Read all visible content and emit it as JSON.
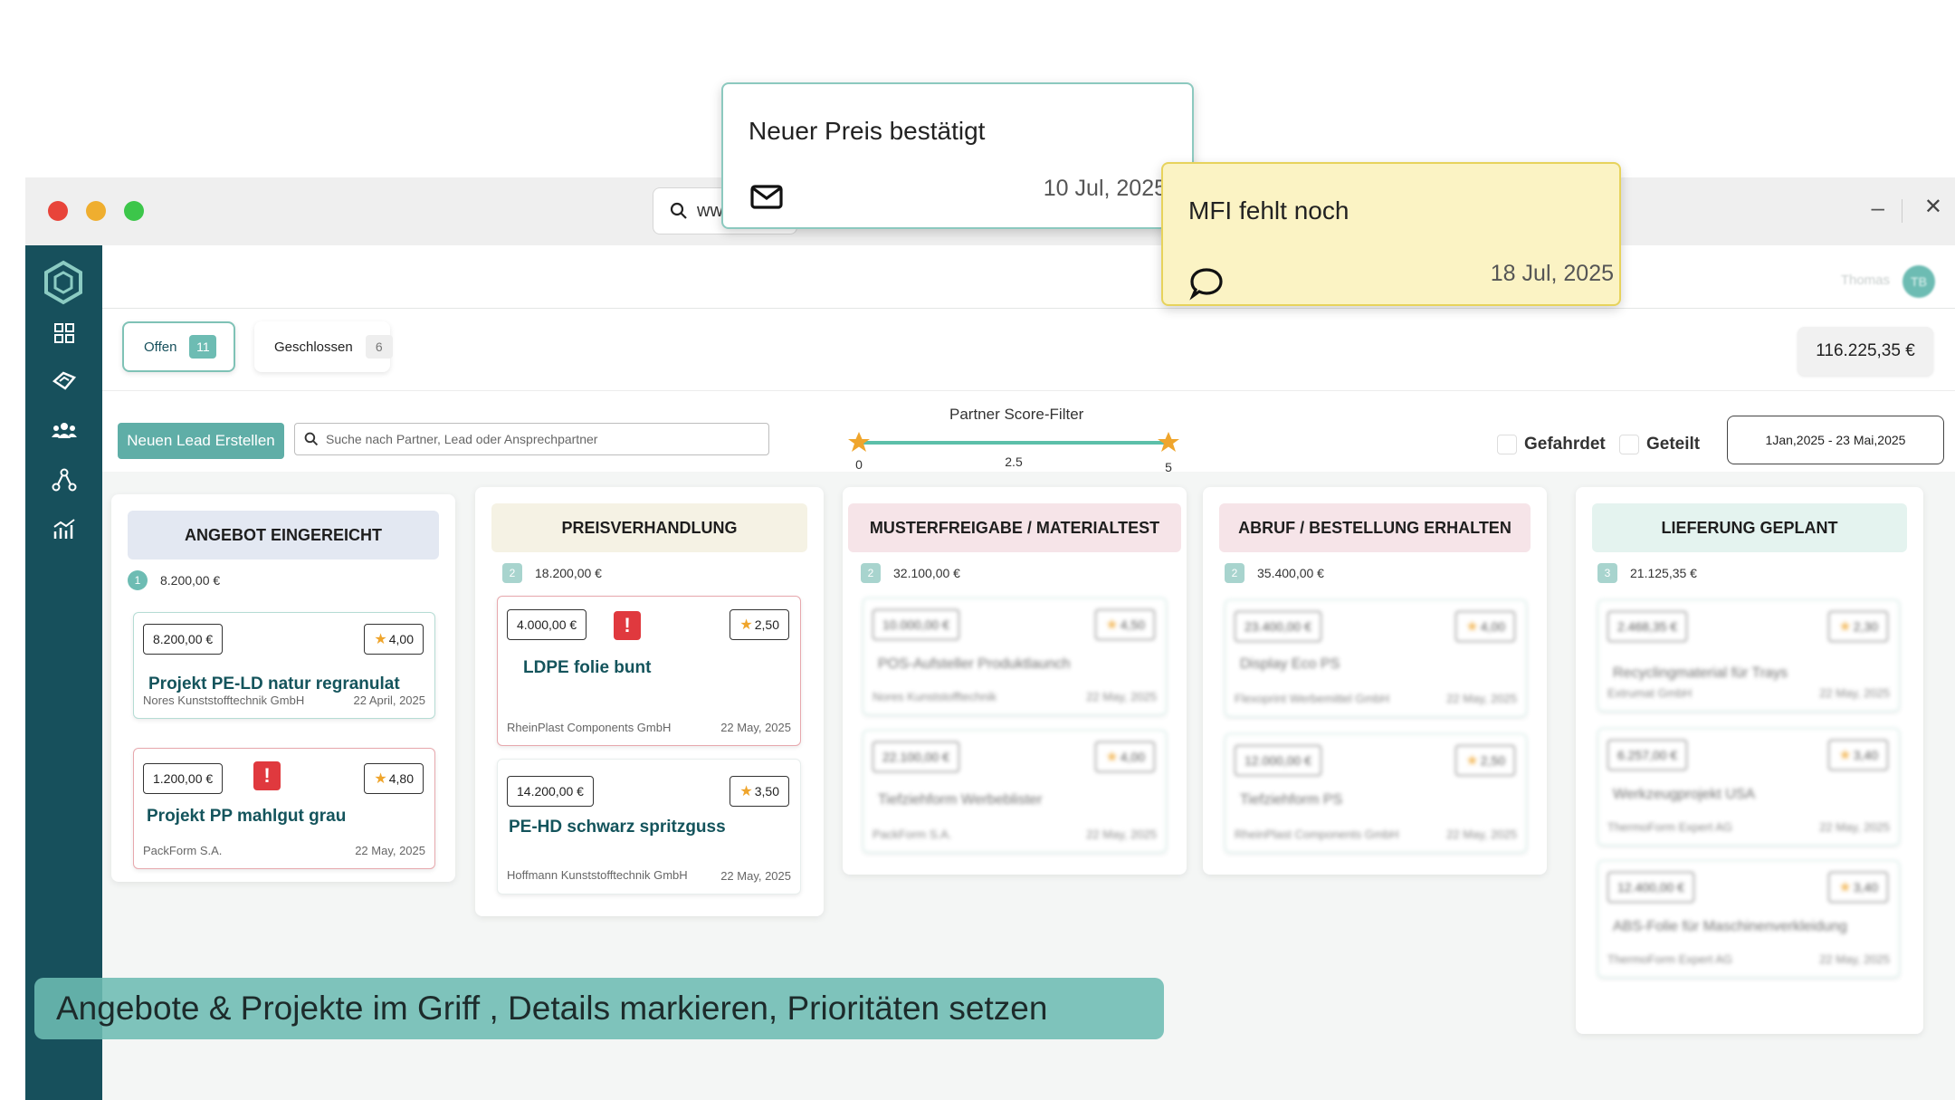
{
  "window": {
    "url_text": "ww",
    "minimize": "–",
    "close": "✕"
  },
  "user": {
    "name": "Thomas",
    "initials": "TB"
  },
  "tabs": {
    "open": {
      "label": "Offen",
      "count": "11"
    },
    "closed": {
      "label": "Geschlossen",
      "count": "6"
    }
  },
  "total": "116.225,35 €",
  "toolbar": {
    "new_lead": "Neuen Lead Erstellen",
    "search_placeholder": "Suche nach Partner, Lead oder Ansprechpartner",
    "score_filter_title": "Partner Score-Filter",
    "slider": {
      "min_label": "0",
      "mid_label": "2.5",
      "max_label": "5",
      "low": 0,
      "high": 5
    },
    "checkbox_danger": "Gefahrdet",
    "checkbox_shared": "Geteilt",
    "date_range": "1Jan,2025 - 23 Mai,2025"
  },
  "columns": [
    {
      "title": "ANGEBOT EINGEREICHT",
      "count": "1",
      "sum": "8.200,00 €",
      "color": "#e3e8f2",
      "cards": [
        {
          "amount": "8.200,00 €",
          "score": "4,00",
          "title": "Projekt PE-LD natur regranulat",
          "company": "Nores Kunststofftechnik  GmbH",
          "date": "22 April, 2025",
          "alert": false
        },
        {
          "amount": "1.200,00 €",
          "score": "4,80",
          "title": "Projekt PP mahlgut grau",
          "company": "PackForm S.A.",
          "date": "22 May, 2025",
          "alert": true
        }
      ]
    },
    {
      "title": "PREISVERHANDLUNG",
      "count": "2",
      "sum": "18.200,00 €",
      "color": "#f5f2e4",
      "cards": [
        {
          "amount": "4.000,00 €",
          "score": "2,50",
          "title": "LDPE folie bunt",
          "company": "RheinPlast Components GmbH",
          "date": "22 May, 2025",
          "alert": true
        },
        {
          "amount": "14.200,00 €",
          "score": "3,50",
          "title": "PE-HD schwarz spritzguss",
          "company": "Hoffmann Kunststofftechnik GmbH",
          "date": "22 May, 2025",
          "alert": false
        }
      ]
    },
    {
      "title": "MUSTERFREIGABE / MATERIALTEST",
      "count": "2",
      "sum": "32.100,00 €",
      "color": "#f6e4e8",
      "cards": [
        {
          "amount": "10.000,00 €",
          "score": "4,50",
          "title": "POS-Aufsteller Produktlaunch",
          "company": "Nores Kunststofftechnik",
          "date": "22 May, 2025"
        },
        {
          "amount": "22.100,00 €",
          "score": "4,00",
          "title": "Tiefziehform Werbeblister",
          "company": "PackForm S.A.",
          "date": "22 May, 2025"
        }
      ]
    },
    {
      "title": "ABRUF / BESTELLUNG ERHALTEN",
      "count": "2",
      "sum": "35.400,00 €",
      "color": "#f6e4e8",
      "cards": [
        {
          "amount": "23.400,00 €",
          "score": "4,00",
          "title": "Display Eco PS",
          "company": "Flexoprint Werbemittel GmbH",
          "date": "22 May, 2025"
        },
        {
          "amount": "12.000,00 €",
          "score": "2,50",
          "title": "Tiefziehform PS",
          "company": "RheinPlast Components GmbH",
          "date": "22 May, 2025"
        }
      ]
    },
    {
      "title": "LIEFERUNG GEPLANT",
      "count": "3",
      "sum": "21.125,35 €",
      "color": "#e4f3ef",
      "cards": [
        {
          "amount": "2.468,35 €",
          "score": "2,30",
          "title": "Recyclingmaterial für Trays",
          "company": "Extrumat GmbH",
          "date": "22 May, 2025"
        },
        {
          "amount": "6.257,00 €",
          "score": "3,40",
          "title": "Werkzeugprojekt USA",
          "company": "ThermoForm Expert AG",
          "date": "22 May, 2025"
        },
        {
          "amount": "12.400,00 €",
          "score": "3,40",
          "title": "ABS-Folie für Maschinenverkleidung",
          "company": "ThermoForm Expert AG",
          "date": "22 May, 2025"
        }
      ]
    }
  ],
  "notifications": [
    {
      "title": "Neuer Preis bestätigt",
      "date": "10 Jul, 2025",
      "icon": "envelope-icon"
    },
    {
      "title": "MFI fehlt noch",
      "date": "18 Jul, 2025",
      "icon": "chat-bubble-icon"
    }
  ],
  "caption": "Angebote & Projekte im Griff , Details markieren, Prioritäten setzen",
  "colors": {
    "sidebar": "#17505c",
    "accent": "#6dbcb3",
    "title_text": "#14545c",
    "alert": "#e0393e",
    "star": "#efa52c"
  }
}
